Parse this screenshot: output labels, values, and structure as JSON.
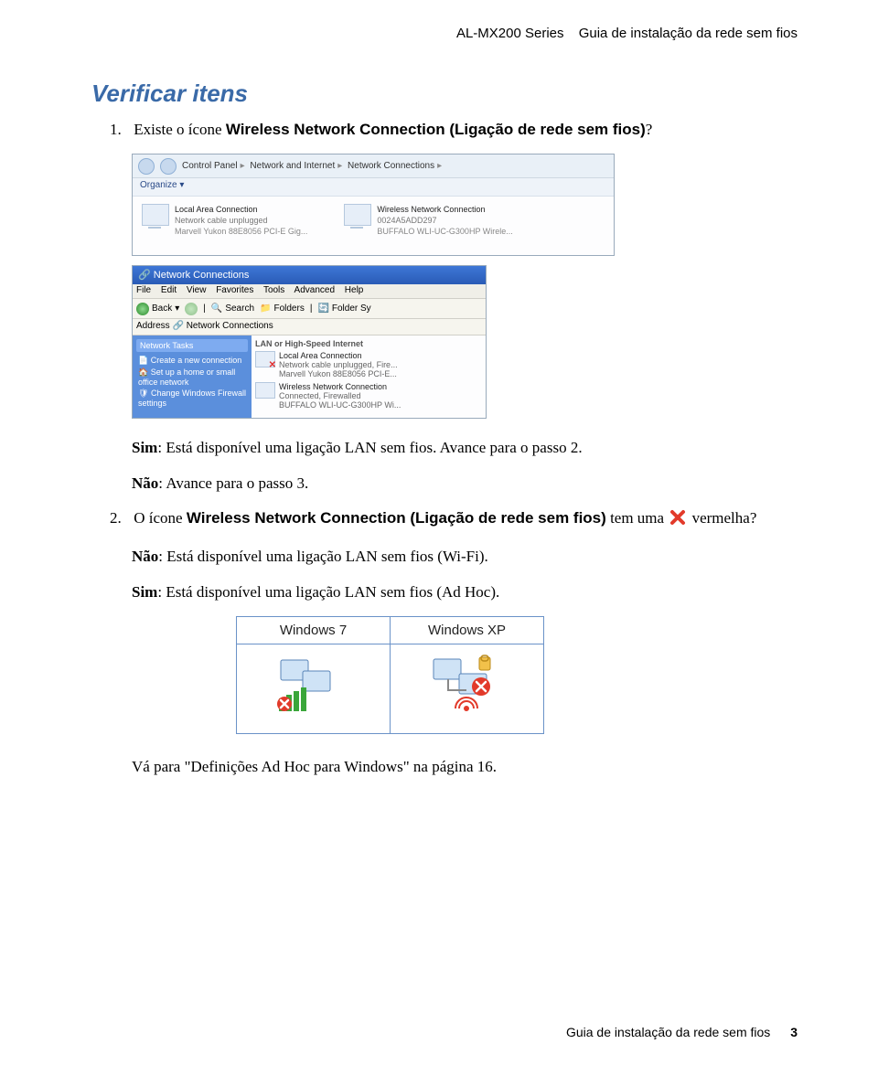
{
  "header": {
    "product": "AL-MX200 Series",
    "guide": "Guia de instalação da rede sem fios"
  },
  "section_title": "Verificar itens",
  "step1": {
    "num": "1.",
    "pre": "Existe o ícone ",
    "bold": "Wireless Network Connection (Ligação de rede sem fios)",
    "post": "?"
  },
  "win7": {
    "crumb1": "Control Panel",
    "crumb2": "Network and Internet",
    "crumb3": "Network Connections",
    "organize": "Organize ▾",
    "lac_title": "Local Area Connection",
    "lac_l2": "Network cable unplugged",
    "lac_l3": "Marvell Yukon 88E8056 PCI-E Gig...",
    "wnc_title": "Wireless Network Connection",
    "wnc_l2": "0024A5ADD297",
    "wnc_l3": "BUFFALO WLI-UC-G300HP Wirele..."
  },
  "xp": {
    "title": "Network Connections",
    "menu": {
      "file": "File",
      "edit": "Edit",
      "view": "View",
      "fav": "Favorites",
      "tools": "Tools",
      "adv": "Advanced",
      "help": "Help"
    },
    "tool": {
      "back": "Back",
      "search": "Search",
      "folders": "Folders",
      "fs": "Folder Sy"
    },
    "addr_label": "Address",
    "addr_val": "Network Connections",
    "tasks_hd": "Network Tasks",
    "t1": "Create a new connection",
    "t2": "Set up a home or small office network",
    "t3": "Change Windows Firewall settings",
    "grp": "LAN or High-Speed Internet",
    "lac_n": "Local Area Connection",
    "lac_s": "Network cable unplugged, Fire...",
    "lac_d": "Marvell Yukon 88E8056 PCI-E...",
    "wnc_n": "Wireless Network Connection",
    "wnc_s": "Connected, Firewalled",
    "wnc_d": "BUFFALO WLI-UC-G300HP Wi..."
  },
  "sim1": {
    "label": "Sim",
    "text": ": Está disponível uma ligação LAN sem fios. Avance para o passo 2."
  },
  "nao1": {
    "label": "Não",
    "text": ": Avance para o passo 3."
  },
  "step2": {
    "num": "2.",
    "pre": "O ícone ",
    "bold": "Wireless Network Connection (Ligação de rede sem fios)",
    "mid": " tem uma ",
    "post": " vermelha?"
  },
  "nao2": {
    "label": "Não",
    "text": ": Está disponível uma ligação LAN sem fios (Wi-Fi)."
  },
  "sim2": {
    "label": "Sim",
    "text": ": Está disponível uma ligação LAN sem fios (Ad Hoc)."
  },
  "table": {
    "h1": "Windows 7",
    "h2": "Windows XP"
  },
  "link": "Vá para \"Definições Ad Hoc para Windows\" na página 16.",
  "footer": {
    "guide": "Guia de instalação da rede sem fios",
    "page": "3"
  }
}
